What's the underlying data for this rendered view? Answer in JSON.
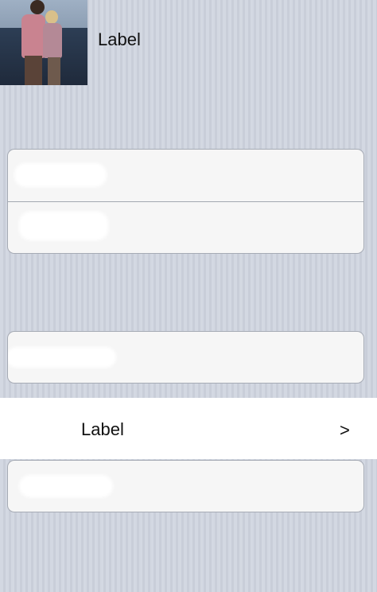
{
  "header": {
    "label": "Label"
  },
  "nav_row": {
    "label": "Label",
    "chevron": ">"
  }
}
